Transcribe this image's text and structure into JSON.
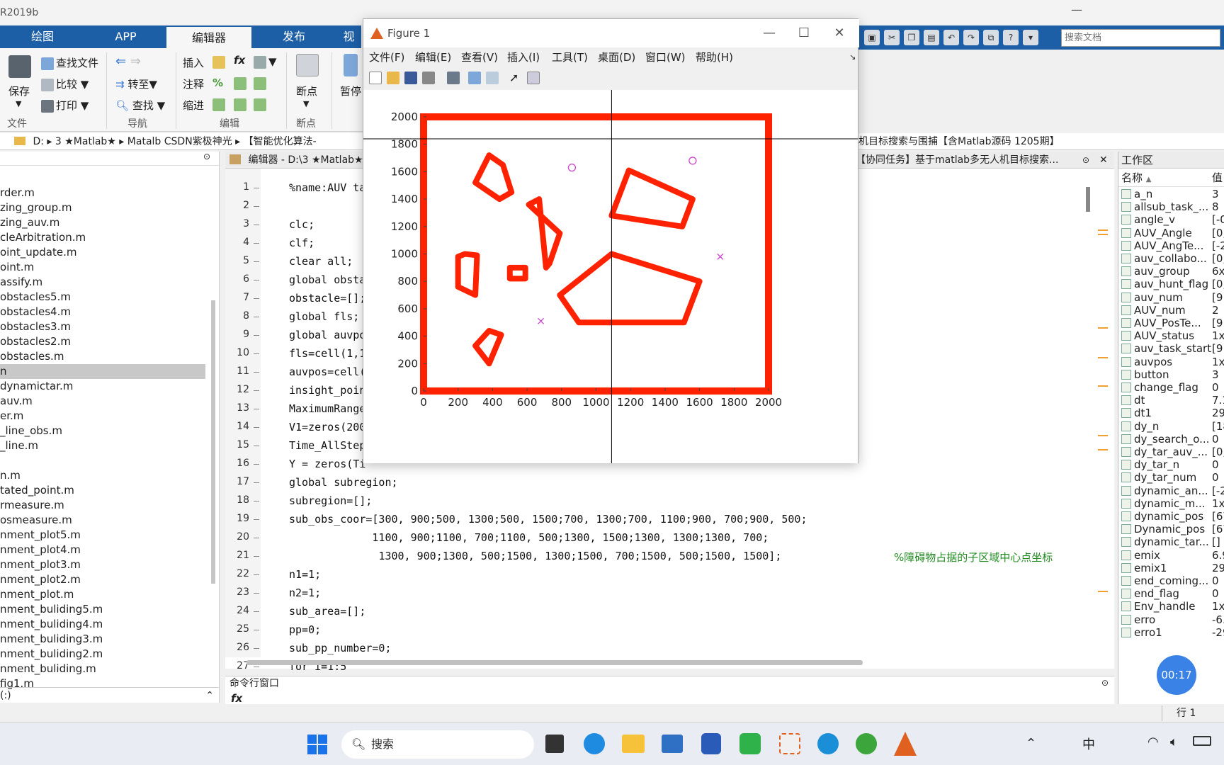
{
  "app": {
    "title": "R2019b",
    "minimize": "—"
  },
  "ribbon": {
    "tabs": [
      "绘图",
      "APP",
      "编辑器",
      "发布",
      "视"
    ],
    "file_group": {
      "save": "保存",
      "find_files": "查找文件",
      "compare": "比较",
      "print": "打印",
      "label": "文件"
    },
    "nav_group": {
      "goto": "转至",
      "find": "查找",
      "label": "导航"
    },
    "edit_group": {
      "insert": "插入",
      "comment": "注释",
      "indent": "缩进",
      "fx": "fx",
      "percent": "%",
      "label": "编辑"
    },
    "breakpoint_group": {
      "breakpoints": "断点",
      "label": "断点"
    },
    "run_group": {
      "pause": "暂停"
    }
  },
  "search": {
    "placeholder": "搜索文档"
  },
  "address": {
    "parts": [
      "D:",
      "3 ★Matlab★",
      "Matalb CSDN紫极神光",
      "【智能优化算法-"
    ],
    "tail": "机目标搜索与围捕【含Matlab源码 1205期】"
  },
  "files": [
    "rder.m",
    "zing_group.m",
    "zing_auv.m",
    "cleArbitration.m",
    "oint_update.m",
    "oint.m",
    "assify.m",
    "obstacles5.m",
    "obstacles4.m",
    "obstacles3.m",
    "obstacles2.m",
    "obstacles.m",
    "n",
    "dynamictar.m",
    "auv.m",
    "er.m",
    "_line_obs.m",
    "_line.m",
    "",
    "n.m",
    "tated_point.m",
    "rmeasure.m",
    "osmeasure.m",
    "nment_plot5.m",
    "nment_plot4.m",
    "nment_plot3.m",
    "nment_plot2.m",
    "nment_plot.m",
    "nment_buliding5.m",
    "nment_buliding4.m",
    "nment_buliding3.m",
    "nment_buliding2.m",
    "nment_buliding.m",
    "fig1.m"
  ],
  "file_footer": "(:)",
  "editor": {
    "header": "编辑器 - D:\\3 ★Matlab★",
    "header_right": "【协同任务】基于matlab多无人机目标搜索...",
    "lines": [
      {
        "n": "1",
        "t": "%name:AUV ta"
      },
      {
        "n": "2",
        "t": ""
      },
      {
        "n": "3",
        "t": "clc;"
      },
      {
        "n": "4",
        "t": "clf;"
      },
      {
        "n": "5",
        "t": "clear all;"
      },
      {
        "n": "6",
        "t": "global obsta"
      },
      {
        "n": "7",
        "t": "obstacle=[];"
      },
      {
        "n": "8",
        "t": "global fls;"
      },
      {
        "n": "9",
        "t": "global auvpo"
      },
      {
        "n": "10",
        "t": "fls=cell(1,1"
      },
      {
        "n": "11",
        "t": "auvpos=cell("
      },
      {
        "n": "12",
        "t": "insight_poin"
      },
      {
        "n": "13",
        "t": "MaximumRange"
      },
      {
        "n": "14",
        "t": "V1=zeros(200"
      },
      {
        "n": "15",
        "t": "Time_AllStep"
      },
      {
        "n": "16",
        "t": "Y = zeros(Ti"
      },
      {
        "n": "17",
        "t": "global subregion;"
      },
      {
        "n": "18",
        "t": "subregion=[];"
      },
      {
        "n": "19",
        "t": "sub_obs_coor=[300, 900;500, 1300;500, 1500;700, 1300;700, 1100;900, 700;900, 500;"
      },
      {
        "n": "20",
        "t": "             1100, 900;1100, 700;1100, 500;1300, 1500;1300, 1300;1300, 700;"
      },
      {
        "n": "21",
        "t": "              1300, 900;1300, 500;1500, 1300;1500, 700;1500, 500;1500, 1500];"
      },
      {
        "n": "22",
        "t": "n1=1;"
      },
      {
        "n": "23",
        "t": "n2=1;"
      },
      {
        "n": "24",
        "t": "sub_area=[];"
      },
      {
        "n": "25",
        "t": "pp=0;"
      },
      {
        "n": "26",
        "t": "sub_pp_number=0;"
      },
      {
        "n": "27",
        "t": "for i=1:5"
      }
    ],
    "comment_21": "%障碍物占据的子区域中心点坐标"
  },
  "command_window": {
    "title": "命令行窗口",
    "prompt": "fx"
  },
  "workspace": {
    "title": "工作区",
    "col_name": "名称",
    "col_value": "值",
    "vars": [
      [
        "a_n",
        "3"
      ],
      [
        "allsub_task_...",
        "8"
      ],
      [
        "angle_v",
        "[-0"
      ],
      [
        "AUV_Angle",
        "[0;"
      ],
      [
        "AUV_AngTe...",
        "[-2"
      ],
      [
        "auv_collabo...",
        "[0,"
      ],
      [
        "auv_group",
        "6x"
      ],
      [
        "auv_hunt_flag",
        "[0;"
      ],
      [
        "auv_num",
        "[9:"
      ],
      [
        "AUV_num",
        "2"
      ],
      [
        "AUV_PosTe...",
        "[9!"
      ],
      [
        "AUV_status",
        "1x"
      ],
      [
        "auv_task_start",
        "[9!"
      ],
      [
        "auvpos",
        "1x"
      ],
      [
        "button",
        "3"
      ],
      [
        "change_flag",
        "0"
      ],
      [
        "dt",
        "7.1"
      ],
      [
        "dt1",
        "29"
      ],
      [
        "dy_n",
        "[18"
      ],
      [
        "dy_search_o...",
        "0"
      ],
      [
        "dy_tar_auv_...",
        "[0;"
      ],
      [
        "dy_tar_n",
        "0"
      ],
      [
        "dy_tar_num",
        "0"
      ],
      [
        "dynamic_an...",
        "[-2"
      ],
      [
        "dynamic_m...",
        "1x"
      ],
      [
        "dynamic_pos",
        "[67"
      ],
      [
        "Dynamic_pos",
        "[67"
      ],
      [
        "dynamic_tar...",
        "[]"
      ],
      [
        "emix",
        "6.9"
      ],
      [
        "emix1",
        "29"
      ],
      [
        "end_coming...",
        "0"
      ],
      [
        "end_flag",
        "0"
      ],
      [
        "Env_handle",
        "1x"
      ],
      [
        "erro",
        "-6."
      ],
      [
        "erro1",
        "-29"
      ]
    ]
  },
  "timer": "00:17",
  "figure": {
    "title": "Figure 1",
    "menu": [
      "文件(F)",
      "编辑(E)",
      "查看(V)",
      "插入(I)",
      "工具(T)",
      "桌面(D)",
      "窗口(W)",
      "帮助(H)"
    ],
    "colors": {
      "obstacle": "#ff2200",
      "target": "#cc44cc"
    }
  },
  "chart_data": {
    "type": "scatter",
    "xlim": [
      0,
      2000
    ],
    "ylim": [
      0,
      2000
    ],
    "xticks": [
      0,
      200,
      400,
      600,
      800,
      1000,
      1200,
      1400,
      1600,
      1800,
      2000
    ],
    "yticks": [
      0,
      200,
      400,
      600,
      800,
      1000,
      1200,
      1400,
      1600,
      1800,
      2000
    ],
    "grid": false,
    "border": [
      [
        0,
        0
      ],
      [
        2000,
        0
      ],
      [
        2000,
        2000
      ],
      [
        0,
        2000
      ]
    ],
    "obstacles": [
      [
        [
          380,
          1720
        ],
        [
          300,
          1520
        ],
        [
          440,
          1400
        ],
        [
          510,
          1450
        ],
        [
          460,
          1650
        ]
      ],
      [
        [
          670,
          1400
        ],
        [
          610,
          1360
        ],
        [
          790,
          1150
        ],
        [
          730,
          930
        ],
        [
          710,
          900
        ]
      ],
      [
        [
          240,
          1000
        ],
        [
          200,
          980
        ],
        [
          200,
          760
        ],
        [
          300,
          700
        ],
        [
          310,
          990
        ]
      ],
      [
        [
          500,
          900
        ],
        [
          590,
          900
        ],
        [
          590,
          820
        ],
        [
          500,
          820
        ]
      ],
      [
        [
          380,
          440
        ],
        [
          300,
          330
        ],
        [
          380,
          200
        ],
        [
          450,
          410
        ]
      ],
      [
        [
          1190,
          1610
        ],
        [
          1090,
          1280
        ],
        [
          1500,
          1200
        ],
        [
          1560,
          1400
        ]
      ],
      [
        [
          1090,
          1000
        ],
        [
          790,
          700
        ],
        [
          900,
          500
        ],
        [
          1510,
          500
        ],
        [
          1600,
          800
        ]
      ]
    ],
    "circles": [
      [
        860,
        1630
      ],
      [
        1560,
        1680
      ]
    ],
    "crosses": [
      [
        1720,
        980
      ],
      [
        680,
        510
      ]
    ],
    "crosshair": [
      1090,
      1840
    ]
  },
  "taskbar": {
    "search": "搜索",
    "clock_hint": "中",
    "status": "行 1"
  }
}
